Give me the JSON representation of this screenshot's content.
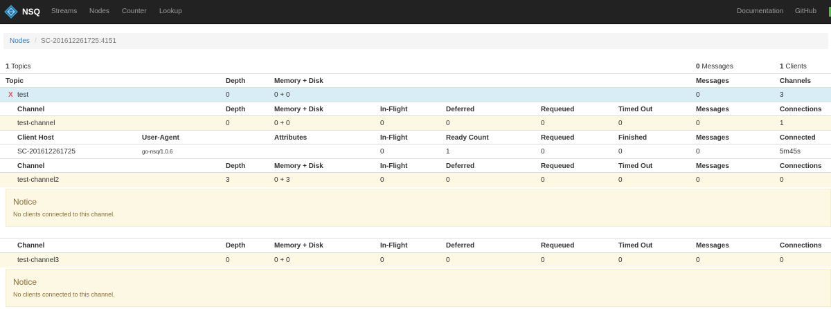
{
  "navbar": {
    "brand": "NSQ",
    "links": [
      "Streams",
      "Nodes",
      "Counter",
      "Lookup"
    ],
    "right_links": [
      "Documentation",
      "GitHub"
    ]
  },
  "breadcrumb": {
    "parent": "Nodes",
    "separator": "/",
    "current": "SC-201612261725:4151"
  },
  "summary": {
    "topics_count": "1",
    "topics_label": " Topics",
    "messages_count": "0",
    "messages_label": " Messages",
    "clients_count": "1",
    "clients_label": " Clients"
  },
  "topic_header": [
    "Topic",
    "Depth",
    "Memory + Disk",
    "Messages",
    "Channels"
  ],
  "topic": {
    "delete_glyph": "X",
    "name": "test",
    "depth": "0",
    "memory_disk": "0 + 0",
    "messages": "0",
    "channels": "3"
  },
  "channel_header": [
    "Channel",
    "Depth",
    "Memory + Disk",
    "In-Flight",
    "Deferred",
    "Requeued",
    "Timed Out",
    "Messages",
    "Connections"
  ],
  "client_header": [
    "Client Host",
    "User-Agent",
    "Attributes",
    "In-Flight",
    "Ready Count",
    "Requeued",
    "Finished",
    "Messages",
    "Connected"
  ],
  "channels": [
    {
      "name": "test-channel",
      "depth": "0",
      "memory_disk": "0 + 0",
      "in_flight": "0",
      "deferred": "0",
      "requeued": "0",
      "timed_out": "0",
      "messages": "0",
      "connections": "1",
      "clients": [
        {
          "host": "SC-201612261725",
          "user_agent": "go-nsq/1.0.6",
          "attributes": "",
          "in_flight": "0",
          "ready_count": "1",
          "requeued": "0",
          "finished": "0",
          "messages": "0",
          "connected": "5m45s"
        }
      ]
    },
    {
      "name": "test-channel2",
      "depth": "3",
      "memory_disk": "0 + 3",
      "in_flight": "0",
      "deferred": "0",
      "requeued": "0",
      "timed_out": "0",
      "messages": "0",
      "connections": "0",
      "notice": {
        "title": "Notice",
        "text": "No clients connected to this channel."
      }
    },
    {
      "name": "test-channel3",
      "depth": "0",
      "memory_disk": "0 + 0",
      "in_flight": "0",
      "deferred": "0",
      "requeued": "0",
      "timed_out": "0",
      "messages": "0",
      "connections": "0",
      "notice": {
        "title": "Notice",
        "text": "No clients connected to this channel."
      }
    }
  ]
}
